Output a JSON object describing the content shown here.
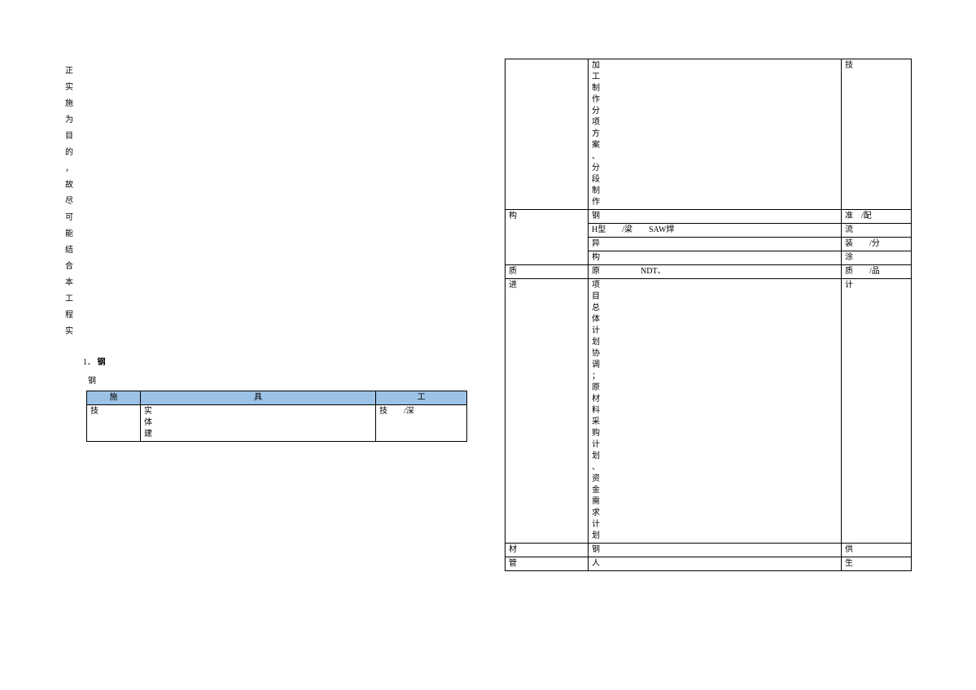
{
  "left": {
    "para_chars": [
      "正",
      "实",
      "施",
      "为",
      "目",
      "的",
      "，",
      "故",
      "尽",
      "可",
      "能",
      "结",
      "合",
      "本",
      "工",
      "程",
      "实"
    ],
    "heading_num": "1．",
    "heading_bold": "钢",
    "sub": "钢",
    "t1": {
      "h1": "施",
      "h2": "具",
      "h3": "工",
      "r1c1": "技",
      "r1c2_chars": [
        "实",
        "体",
        "建"
      ],
      "r1c3": "技　　/深"
    }
  },
  "right": {
    "r0c2_chars": [
      "加",
      "工",
      "制",
      "作",
      "分",
      "项",
      "方",
      "案",
      "、",
      "分",
      "段",
      "制",
      "作"
    ],
    "r0c3": "技",
    "r1c1": "构",
    "r1c2": "钢",
    "r1c3": "准　/配",
    "r2c2": "H型　　/梁　　SAW焊",
    "r2c3": "流",
    "r3c2": "异",
    "r3c3": "装　　/分",
    "r4c2": "构",
    "r4c3": "涂",
    "r5c1": "质",
    "r5c2": "原　　　　　NDT、",
    "r5c3": "质　　/品",
    "r6c1": "进",
    "r6c2_chars": [
      "项",
      "目",
      "总",
      "体",
      "计",
      "划",
      "协",
      "调",
      "；",
      "原",
      "材",
      "料",
      "采",
      "购",
      "计",
      "划",
      "、",
      "资",
      "金",
      "需",
      "求",
      "计",
      "划"
    ],
    "r6c3": "计",
    "r7c1": "材",
    "r7c2": "钢",
    "r7c3": "供",
    "r8c1": "管",
    "r8c2": "人",
    "r8c3": "生"
  }
}
